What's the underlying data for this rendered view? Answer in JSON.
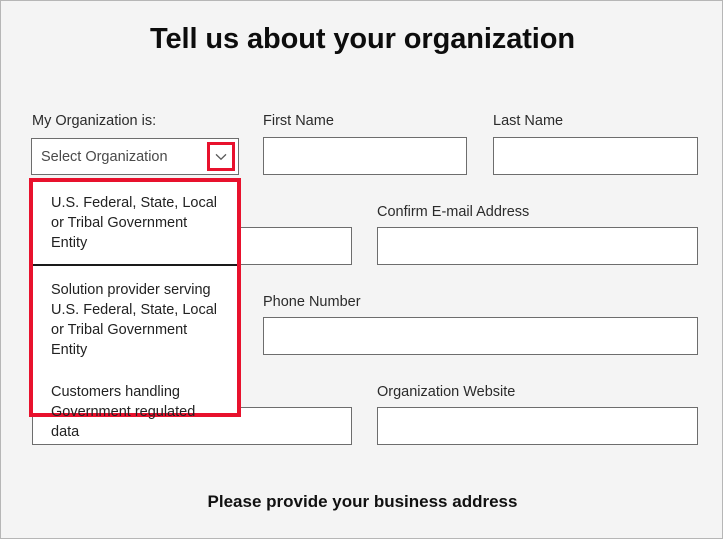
{
  "page": {
    "title": "Tell us about your organization",
    "section_subtitle": "Please provide your business address",
    "background_color": "#f4f4f4",
    "accent_color": "#e8112d",
    "input_border_color": "#6d6d6d"
  },
  "organization_select": {
    "label": "My Organization is:",
    "selected_value": "Select Organization",
    "expanded": true,
    "arrow_icon": "chevron-down-icon",
    "arrow_highlight_color": "#e8112d",
    "options": [
      "U.S. Federal, State, Local or Tribal Government Entity",
      "Solution provider serving U.S. Federal, State, Local or Tribal Government Entity",
      "Customers handling Government regulated data"
    ]
  },
  "fields": {
    "first_name": {
      "label": "First Name",
      "value": "",
      "placeholder": ""
    },
    "last_name": {
      "label": "Last Name",
      "value": "",
      "placeholder": ""
    },
    "email_address": {
      "label": "",
      "value": "",
      "placeholder": ""
    },
    "confirm_email_address": {
      "label": "Confirm E-mail Address",
      "value": "",
      "placeholder": ""
    },
    "phone_number": {
      "label": "Phone Number",
      "value": "",
      "placeholder": ""
    },
    "organization_name": {
      "label": "",
      "value": "",
      "placeholder": ""
    },
    "organization_website": {
      "label": "Organization Website",
      "value": "",
      "placeholder": ""
    },
    "hidden_field_left": {
      "label": "",
      "value": "",
      "placeholder": ""
    }
  }
}
